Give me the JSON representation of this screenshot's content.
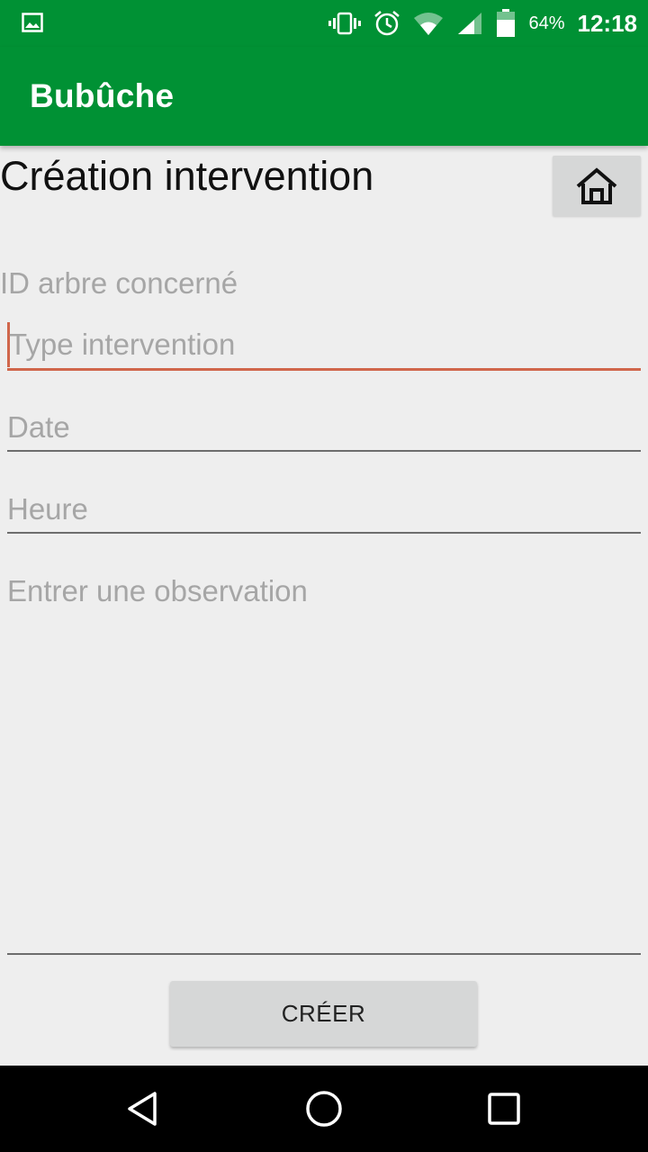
{
  "status_bar": {
    "battery_percent": "64%",
    "time": "12:18",
    "icons": [
      "gallery-icon",
      "vibrate-icon",
      "alarm-icon",
      "wifi-icon",
      "signal-icon",
      "battery-icon"
    ]
  },
  "app_bar": {
    "title": "Bubûche"
  },
  "form": {
    "title": "Création intervention",
    "home_icon": "home-icon",
    "tree_id_label": "ID arbre concerné",
    "type_placeholder": "Type intervention",
    "date_placeholder": "Date",
    "time_placeholder": "Heure",
    "observation_placeholder": "Entrer une observation",
    "create_button": "CRÉER"
  },
  "nav_bar": {
    "icons": [
      "back-icon",
      "home-circle-icon",
      "recents-icon"
    ]
  },
  "colors": {
    "primary": "#009134",
    "accent": "#d0664b",
    "background": "#eeeeee",
    "button": "#d6d7d7"
  }
}
